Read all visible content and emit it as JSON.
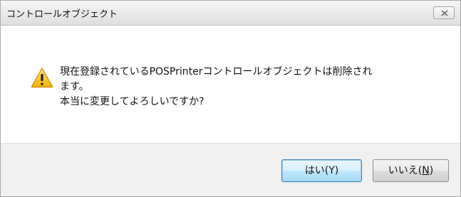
{
  "window": {
    "title": "コントロールオブジェクト"
  },
  "message": {
    "line1": "現在登録されているPOSPrinterコントロールオブジェクトは削除され",
    "line2": "ます。",
    "line3": "本当に変更してよろしいですか?"
  },
  "buttons": {
    "yes_label": "はい(Y)",
    "no_prefix": "いいえ(",
    "no_mnemonic": "N",
    "no_suffix": ")"
  },
  "icons": {
    "close": "close-icon",
    "warning": "warning-icon"
  },
  "colors": {
    "warning_fill": "#f5c01a",
    "default_button_border": "#3c7fb1"
  }
}
